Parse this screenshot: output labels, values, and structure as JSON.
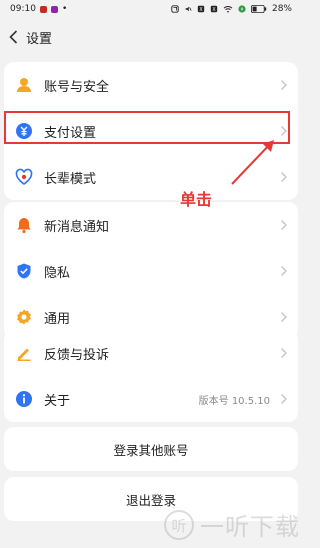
{
  "status_bar": {
    "time": "09:10",
    "battery": "28%"
  },
  "header": {
    "title": "设置"
  },
  "groups": {
    "account": {
      "account_security": "账号与安全",
      "payment_settings": "支付设置",
      "elder_mode": "长辈模式"
    },
    "general": {
      "new_message_notify": "新消息通知",
      "privacy": "隐私",
      "general": "通用"
    },
    "info": {
      "feedback": "反馈与投诉",
      "about": "关于",
      "version": "版本号 10.5.10"
    }
  },
  "buttons": {
    "login_other": "登录其他账号",
    "logout": "退出登录"
  },
  "annotation": {
    "text": "单击"
  },
  "watermark": {
    "text": "一听下载"
  },
  "colors": {
    "highlight": "#e53935",
    "notify": "#f26b1d",
    "privacy": "#2f74f5",
    "general": "#f5a623",
    "account": "#f5a623",
    "payment": "#2f74f5"
  }
}
